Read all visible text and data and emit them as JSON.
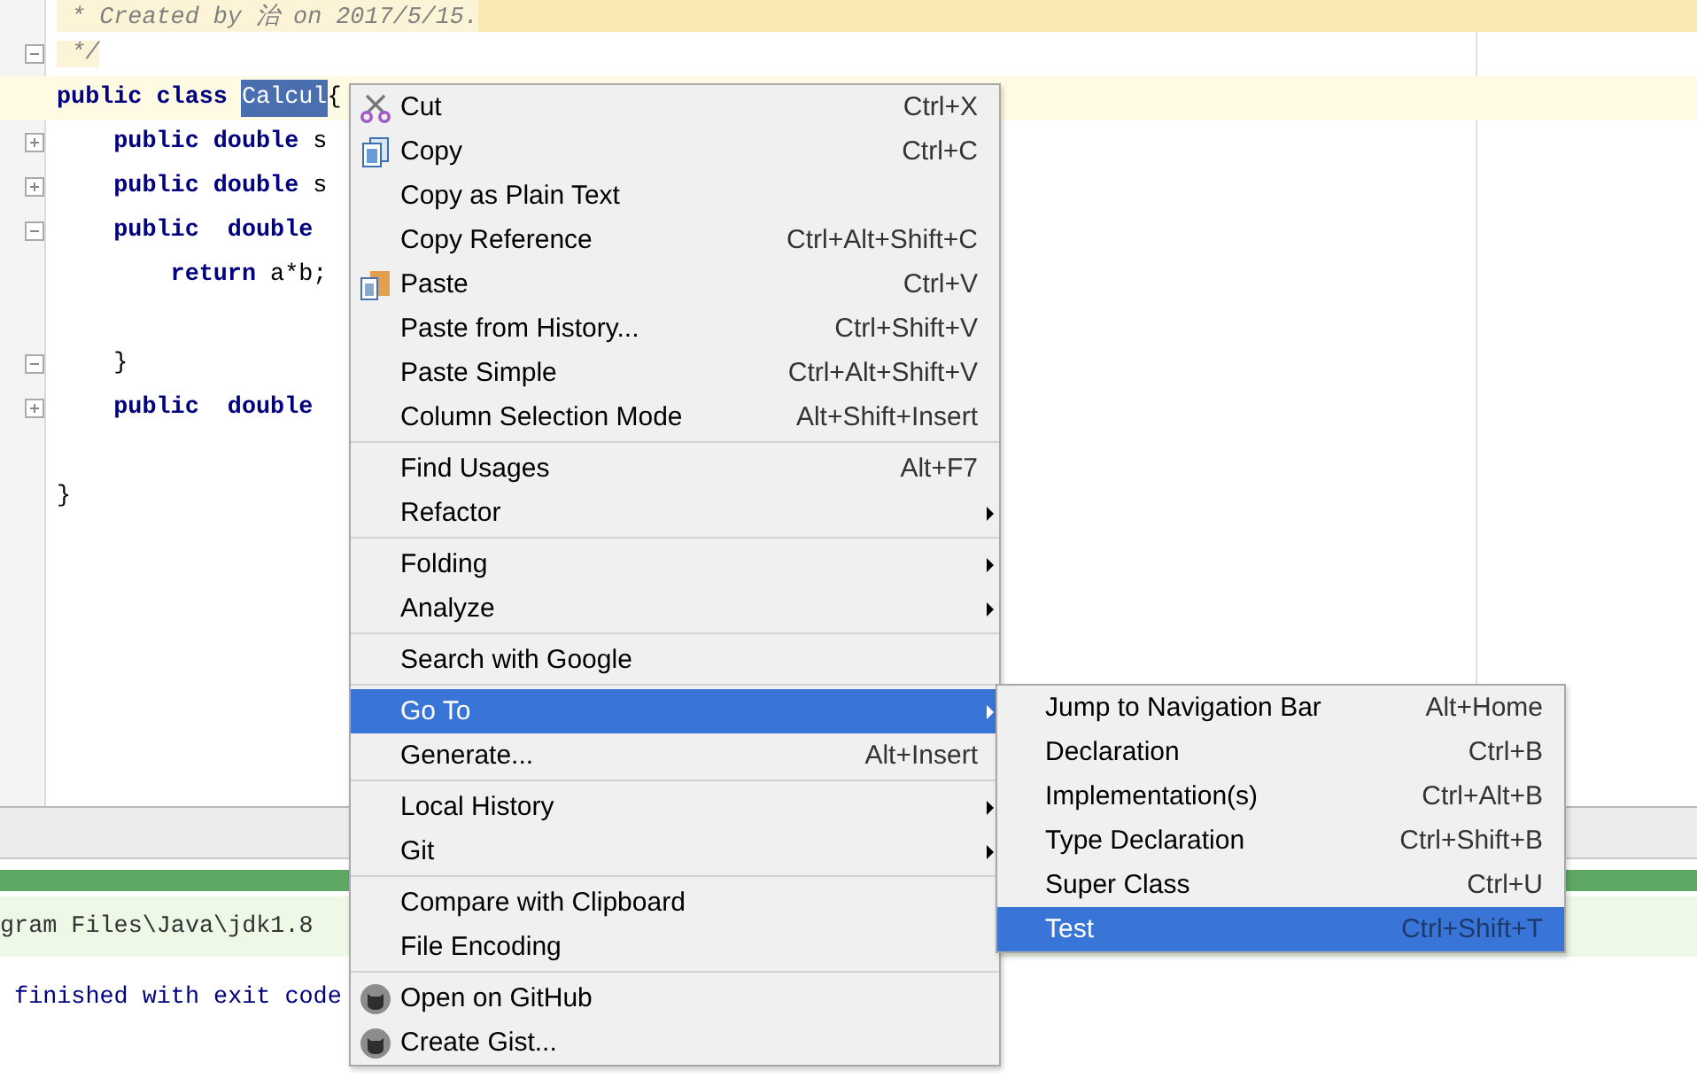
{
  "editor": {
    "lines": [
      {
        "kind": "doc",
        "tokens": [
          {
            "text": " * Created by 治 on 2017/5/15.",
            "kind": "comment"
          }
        ]
      },
      {
        "expanded": true,
        "kind": "doc-end",
        "tokens": [
          {
            "text": " */",
            "kind": "comment"
          }
        ]
      },
      {
        "kind": "current",
        "tokens": [
          {
            "text": "public class ",
            "kind": "keyword"
          },
          {
            "text": "Calcul",
            "kind": "selected"
          },
          {
            "text": "{",
            "kind": "plain"
          }
        ]
      },
      {
        "expanded": false,
        "kind": "code",
        "tokens": [
          {
            "text": "    public double ",
            "kind": "keyword"
          },
          {
            "text": "s",
            "kind": "plain"
          }
        ]
      },
      {
        "expanded": false,
        "kind": "code",
        "tokens": [
          {
            "text": "    public double ",
            "kind": "keyword"
          },
          {
            "text": "s",
            "kind": "plain"
          }
        ]
      },
      {
        "expanded": true,
        "kind": "code",
        "tokens": [
          {
            "text": "    public  double ",
            "kind": "keyword"
          }
        ]
      },
      {
        "kind": "code",
        "tokens": [
          {
            "text": "        return ",
            "kind": "keyword"
          },
          {
            "text": "a*b;",
            "kind": "plain"
          }
        ]
      },
      {
        "kind": "code"
      },
      {
        "expanded": true,
        "kind": "code",
        "tokens": [
          {
            "text": "    }",
            "kind": "plain"
          }
        ]
      },
      {
        "expanded": false,
        "kind": "code",
        "tokens": [
          {
            "text": "    public  double ",
            "kind": "keyword"
          }
        ]
      },
      {
        "kind": "code"
      },
      {
        "kind": "code",
        "tokens": [
          {
            "text": "}",
            "kind": "plain"
          }
        ]
      }
    ]
  },
  "run_panel": {
    "progress": {
      "level": 1
    },
    "console_lines": [
      {
        "text": "gram Files\\Java\\jdk1.8",
        "highlighted": true
      },
      {
        "text": " finished with exit code",
        "highlighted": false
      }
    ]
  },
  "context_menu": {
    "items": [
      {
        "kind": "scissors-item",
        "label": "Cut",
        "shortcut": "Ctrl+X",
        "submenu": false,
        "selected": false
      },
      {
        "kind": "copy-item",
        "label": "Copy",
        "shortcut": "Ctrl+C",
        "submenu": false,
        "selected": false
      },
      {
        "kind": "item",
        "label": "Copy as Plain Text",
        "submenu": false,
        "selected": false
      },
      {
        "kind": "item",
        "label": "Copy Reference",
        "shortcut": "Ctrl+Alt+Shift+C",
        "submenu": false,
        "selected": false
      },
      {
        "kind": "paste-item",
        "label": "Paste",
        "shortcut": "Ctrl+V",
        "submenu": false,
        "selected": false
      },
      {
        "kind": "item",
        "label": "Paste from History...",
        "shortcut": "Ctrl+Shift+V",
        "submenu": false,
        "selected": false
      },
      {
        "kind": "item",
        "label": "Paste Simple",
        "shortcut": "Ctrl+Alt+Shift+V",
        "submenu": false,
        "selected": false
      },
      {
        "kind": "item",
        "label": "Column Selection Mode",
        "shortcut": "Alt+Shift+Insert",
        "submenu": false,
        "selected": false
      },
      {
        "kind": "separator"
      },
      {
        "kind": "item",
        "label": "Find Usages",
        "shortcut": "Alt+F7",
        "submenu": false,
        "selected": false
      },
      {
        "kind": "item",
        "label": "Refactor",
        "submenu": true,
        "selected": false
      },
      {
        "kind": "separator"
      },
      {
        "kind": "item",
        "label": "Folding",
        "submenu": true,
        "selected": false
      },
      {
        "kind": "item",
        "label": "Analyze",
        "submenu": true,
        "selected": false
      },
      {
        "kind": "separator"
      },
      {
        "kind": "item",
        "label": "Search with Google",
        "submenu": false,
        "selected": false
      },
      {
        "kind": "separator"
      },
      {
        "kind": "item",
        "label": "Go To",
        "submenu": true,
        "selected": true
      },
      {
        "kind": "item",
        "label": "Generate...",
        "shortcut": "Alt+Insert",
        "submenu": false,
        "selected": false
      },
      {
        "kind": "separator"
      },
      {
        "kind": "item",
        "label": "Local History",
        "submenu": true,
        "selected": false
      },
      {
        "kind": "item",
        "label": "Git",
        "submenu": true,
        "selected": false
      },
      {
        "kind": "separator"
      },
      {
        "kind": "item",
        "label": "Compare with Clipboard",
        "submenu": false,
        "selected": false
      },
      {
        "kind": "item",
        "label": "File Encoding",
        "submenu": false,
        "selected": false
      },
      {
        "kind": "separator"
      },
      {
        "kind": "cat-item",
        "label": "Open on GitHub",
        "submenu": false,
        "selected": false
      },
      {
        "kind": "cat-item",
        "label": "Create Gist...",
        "submenu": false,
        "selected": false
      }
    ]
  },
  "submenu": {
    "items": [
      {
        "label": "Jump to Navigation Bar",
        "shortcut": "Alt+Home",
        "selected": false
      },
      {
        "label": "Declaration",
        "shortcut": "Ctrl+B",
        "selected": false
      },
      {
        "label": "Implementation(s)",
        "shortcut": "Ctrl+Alt+B",
        "selected": false
      },
      {
        "label": "Type Declaration",
        "shortcut": "Ctrl+Shift+B",
        "selected": false
      },
      {
        "label": "Super Class",
        "shortcut": "Ctrl+U",
        "selected": false
      },
      {
        "label": "Test",
        "shortcut": "Ctrl+Shift+T",
        "selected": true
      }
    ]
  }
}
